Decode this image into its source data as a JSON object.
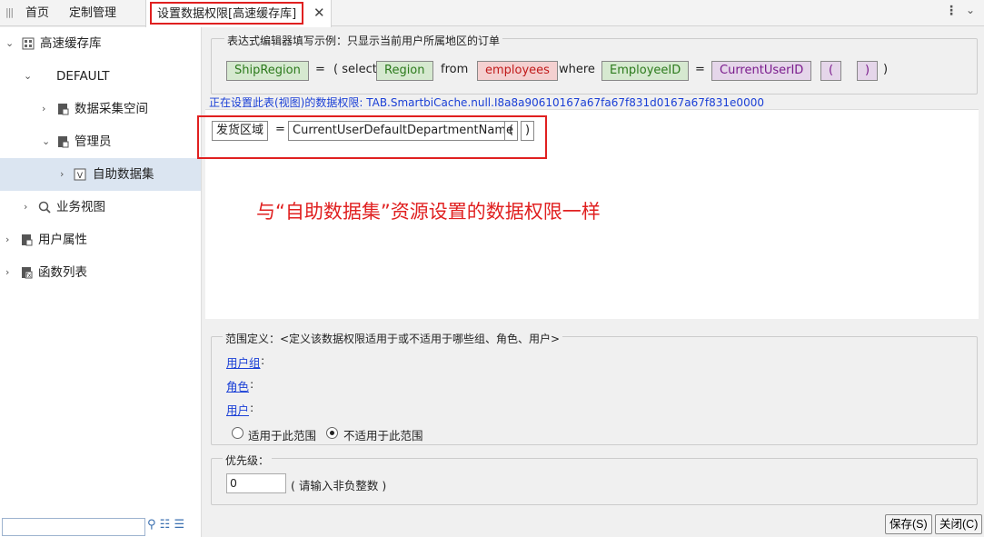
{
  "tabs": {
    "home": "首页",
    "custom": "定制管理",
    "active": "设置数据权限[高速缓存库]"
  },
  "sidebar": {
    "items": [
      {
        "label": "高速缓存库",
        "icon": "database-icon"
      },
      {
        "label": "DEFAULT",
        "icon": ""
      },
      {
        "label": "数据采集空间",
        "icon": "folder-icon"
      },
      {
        "label": "管理员",
        "icon": "folder-icon"
      },
      {
        "label": "自助数据集",
        "icon": "dataset-icon"
      },
      {
        "label": "业务视图",
        "icon": "search-icon"
      },
      {
        "label": "用户属性",
        "icon": "user-attr-icon"
      },
      {
        "label": "函数列表",
        "icon": "function-icon"
      }
    ],
    "search_placeholder": ""
  },
  "example": {
    "title": "表达式编辑器填写示例：只显示当前用户所属地区的订单",
    "tokens": [
      "ShipRegion",
      "=",
      "( select",
      "Region",
      "from",
      "employees",
      "where",
      "EmployeeID",
      "=",
      "CurrentUserID",
      "(",
      ")",
      ")"
    ]
  },
  "path_line": "正在设置此表(视图)的数据权限: TAB.SmartbiCache.null.I8a8a90610167a67fa67f831d0167a67f831e0000",
  "editor": {
    "tokens": [
      "发货区域",
      "=",
      "CurrentUserDefaultDepartmentName",
      "(",
      ")"
    ],
    "annotation": "与“自助数据集”资源设置的数据权限一样"
  },
  "range": {
    "title": "范围定义：<定义该数据权限适用于或不适用于哪些组、角色、用户>",
    "user_group": "用户组",
    "role": "角色",
    "user": "用户",
    "colon": ":",
    "option_apply": "适用于此范围",
    "option_not_apply": "不适用于此范围",
    "selected": "option_not_apply"
  },
  "priority": {
    "title": "优先级：",
    "value": "0",
    "hint": "( 请输入非负整数 )"
  },
  "buttons": {
    "save": "保存(S)",
    "close": "关闭(C)"
  },
  "colors": {
    "highlight": "#e02020",
    "link": "#1a3fd6",
    "selected_row": "#dbe5f1"
  }
}
